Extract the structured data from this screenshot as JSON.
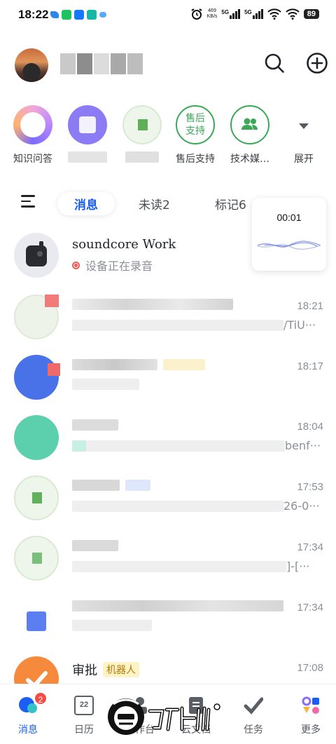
{
  "status_bar": {
    "time": "18:22",
    "net_speed": "469",
    "net_unit": "KB/s",
    "sig1": "5G",
    "sig2": "5G",
    "battery": "89"
  },
  "header": {
    "search_icon": "search-icon",
    "add_icon": "plus-circle-icon"
  },
  "quick_actions": [
    {
      "label": "知识问答"
    },
    {
      "label": ""
    },
    {
      "label": ""
    },
    {
      "label": "售后支持",
      "icon_text_1": "售后",
      "icon_text_2": "支持"
    },
    {
      "label": "技术媒…"
    },
    {
      "label": "展开"
    }
  ],
  "tabs": [
    {
      "label": "消息"
    },
    {
      "label": "未读2"
    },
    {
      "label": "标记6"
    }
  ],
  "recording": {
    "timer": "00:01"
  },
  "messages": [
    {
      "title": "soundcore Work",
      "subtitle": "设备正在录音",
      "time": ""
    },
    {
      "title": "",
      "subtitle": "/TiU···",
      "time": "18:21"
    },
    {
      "title": "",
      "subtitle": "",
      "time": "18:17"
    },
    {
      "title": "",
      "subtitle": "benf···",
      "time": "18:04"
    },
    {
      "title": "",
      "subtitle": "26-0···",
      "time": "17:53"
    },
    {
      "title": "",
      "subtitle": "]-[···",
      "time": "17:34"
    },
    {
      "title": "",
      "subtitle": "",
      "time": "17:34"
    },
    {
      "title": "审批",
      "tag": "机器人",
      "subtitle": "",
      "time": "17:08"
    }
  ],
  "bottom_nav": [
    {
      "label": "消息",
      "badge": "2"
    },
    {
      "label": "日历",
      "icon_text": "22"
    },
    {
      "label": "工作台"
    },
    {
      "label": "云文档"
    },
    {
      "label": "任务"
    },
    {
      "label": "更多"
    }
  ],
  "colors": {
    "accent": "#1b5ef5",
    "badge": "#f54a45",
    "tag_bg": "#fdf3c7",
    "tag_fg": "#b07d09",
    "green": "#3aa857"
  }
}
